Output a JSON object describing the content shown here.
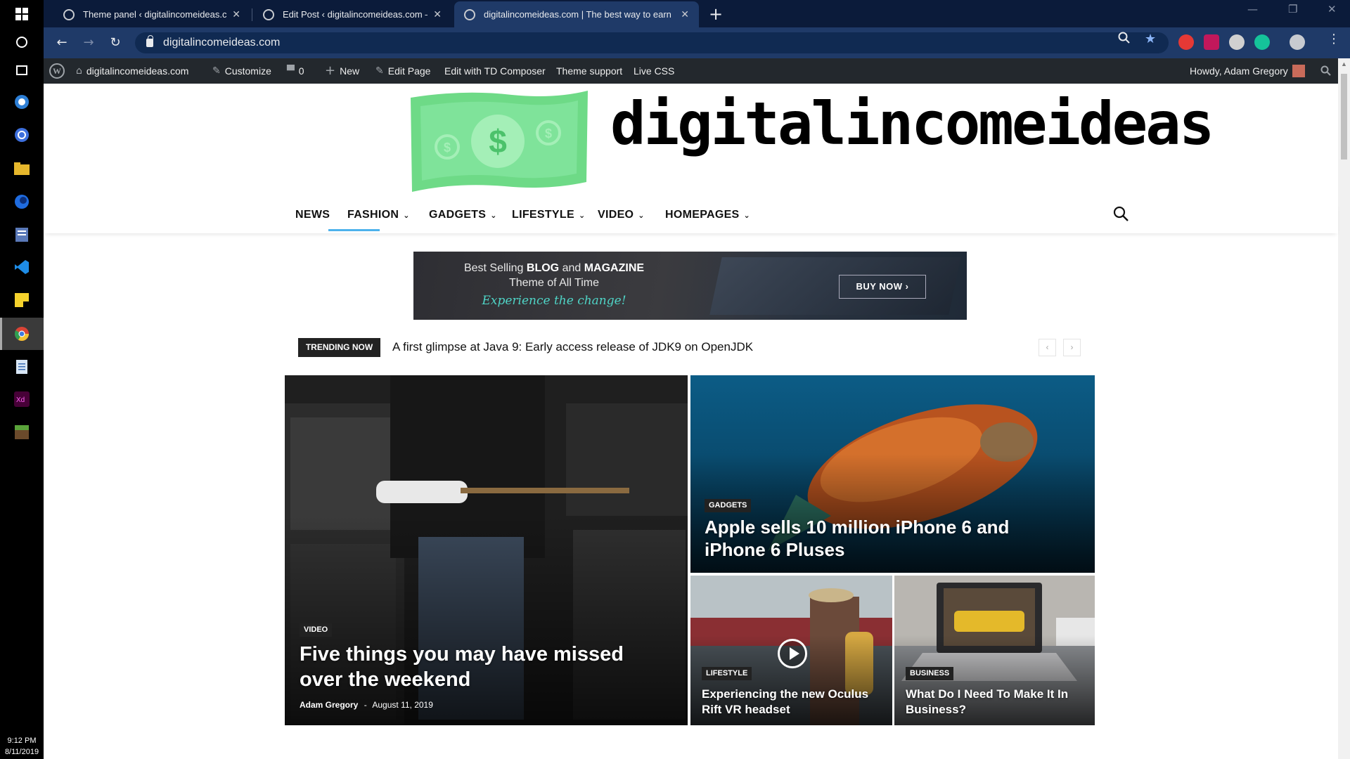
{
  "taskbar": {
    "time": "9:12 PM",
    "date": "8/11/2019"
  },
  "browser": {
    "tabs": [
      {
        "title": "Theme panel ‹ digitalincomeideas.com"
      },
      {
        "title": "Edit Post ‹ digitalincomeideas.com — WordPress"
      },
      {
        "title": "digitalincomeideas.com | The best way to earn"
      }
    ],
    "url": "digitalincomeideas.com"
  },
  "admin_bar": {
    "site": "digitalincomeideas.com",
    "customize": "Customize",
    "comments": "0",
    "new": "New",
    "edit_page": "Edit Page",
    "td_composer": "Edit with TD Composer",
    "theme_support": "Theme support",
    "live_css": "Live CSS",
    "howdy": "Howdy, Adam Gregory"
  },
  "site": {
    "name": "digitalincomeideas",
    "menu": [
      "NEWS",
      "FASHION",
      "GADGETS",
      "LIFESTYLE",
      "VIDEO",
      "HOMEPAGES"
    ],
    "banner": {
      "line1_pre": "Best Selling",
      "line1_b1": "BLOG",
      "line1_mid": "and",
      "line1_b2": "MAGAZINE",
      "line2": "Theme of All Time",
      "line3": "Experience the change!",
      "button": "BUY NOW ›"
    },
    "trending": {
      "label": "TRENDING NOW",
      "text": "A first glimpse at Java 9: Early access release of JDK9 on OpenJDK"
    },
    "posts": [
      {
        "category": "VIDEO",
        "title": "Five things you may have missed over the weekend",
        "author": "Adam Gregory",
        "separator": "-",
        "date": "August 11, 2019"
      },
      {
        "category": "GADGETS",
        "title": "Apple sells 10 million iPhone 6 and iPhone 6 Pluses"
      },
      {
        "category": "LIFESTYLE",
        "title": "Experiencing the new Oculus Rift VR headset"
      },
      {
        "category": "BUSINESS",
        "title": "What Do I Need To Make It In Business?"
      }
    ]
  },
  "colors": {
    "tab_bar": "#0b1b3a",
    "toolbar": "#1f3a68",
    "admin_bar": "#23282d",
    "accent": "#4db2ec",
    "logo_green": "#5ed67a"
  }
}
